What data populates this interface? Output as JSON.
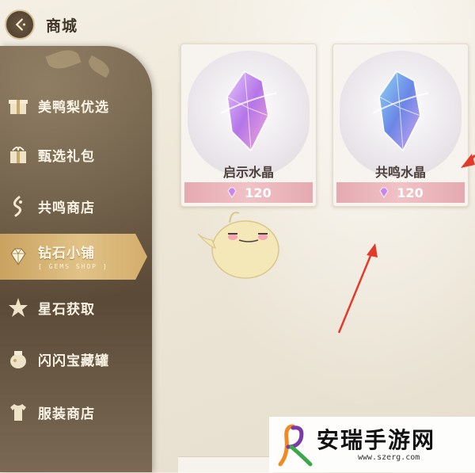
{
  "header": {
    "title": "商城"
  },
  "sidebar": {
    "items": [
      {
        "label": "美鸭梨优选",
        "icon": "gift-box-icon"
      },
      {
        "label": "甄选礼包",
        "icon": "gift-package-icon"
      },
      {
        "label": "共鸣商店",
        "icon": "resonance-swirl-icon"
      },
      {
        "label": "钻石小铺",
        "icon": "diamond-icon",
        "sub": "[ GEMS SHOP ]"
      },
      {
        "label": "星石获取",
        "icon": "star-stone-icon"
      },
      {
        "label": "闪闪宝藏罐",
        "icon": "treasure-jar-icon"
      },
      {
        "label": "服装商店",
        "icon": "clothing-icon"
      }
    ]
  },
  "products": [
    {
      "name": "启示水晶",
      "price": "120",
      "crystal_color": "#c07ff0"
    },
    {
      "name": "共鸣水晶",
      "price": "120",
      "crystal_color": "#7aa6f0"
    }
  ],
  "watermark": {
    "text": "安瑞手游网",
    "url": "www.szerg.com"
  },
  "colors": {
    "accent_gold": "#d9b877",
    "price_pink": "#e9b2b8",
    "arrow_red": "#e23b2b"
  }
}
